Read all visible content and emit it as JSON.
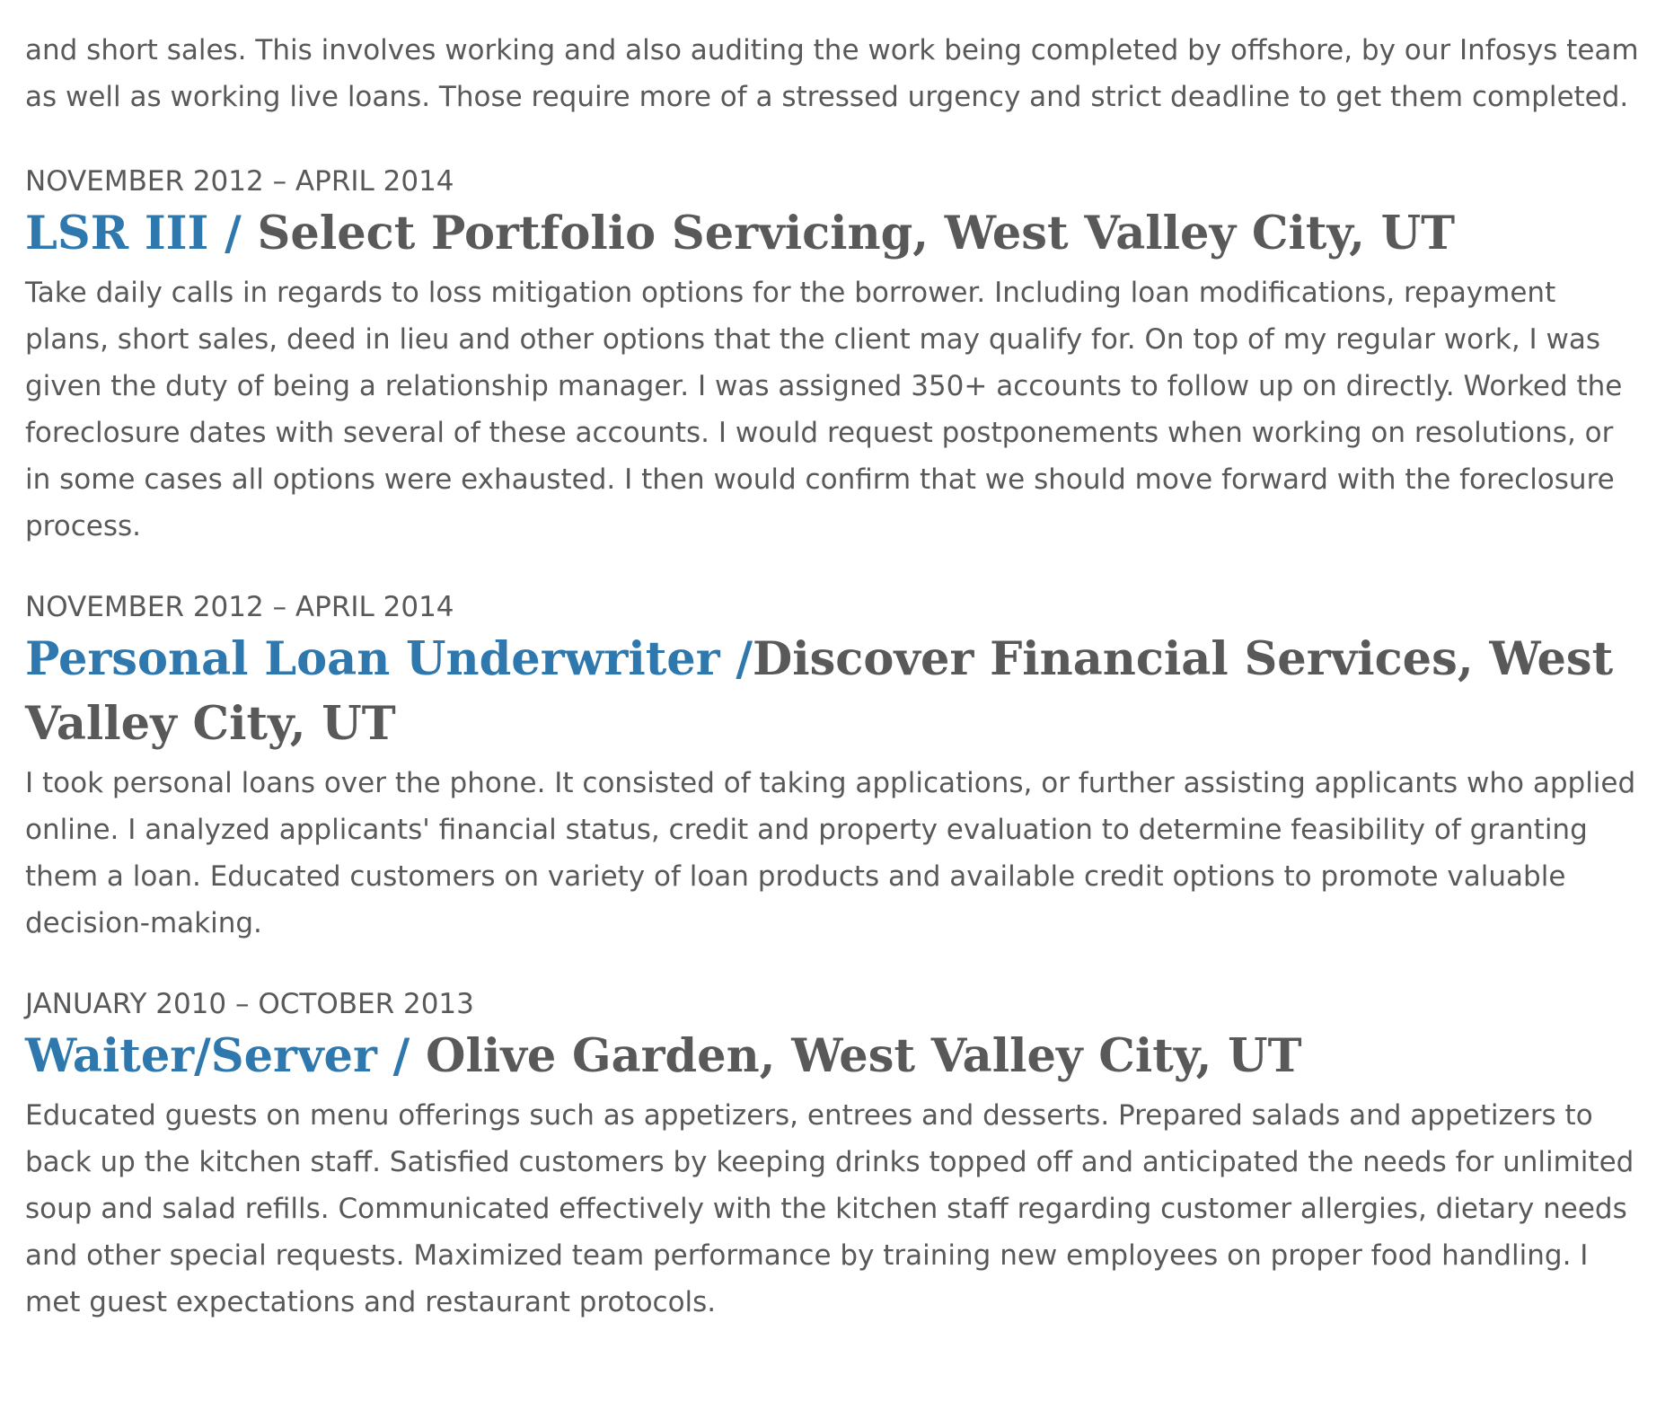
{
  "intro": "and short sales. This involves working and also auditing the work being completed by offshore, by our Infosys team as well as working live loans. Those require more of a stressed urgency and strict deadline to get them completed.",
  "jobs": [
    {
      "dates": "NOVEMBER 2012 – APRIL 2014",
      "role": "LSR III / ",
      "company": "Select Portfolio Servicing, West Valley City, UT",
      "description": "Take daily calls in regards to loss mitigation options for the borrower. Including loan modifications, repayment plans, short sales, deed in lieu and other options that the client may qualify for. On top of my regular work, I was given the duty of being a relationship manager. I was assigned 350+ accounts to follow up on directly. Worked the foreclosure dates with several of these accounts. I would request postponements when working on resolutions, or in some cases all options were exhausted. I then would confirm that we should move forward with the foreclosure process."
    },
    {
      "dates": "NOVEMBER 2012 – APRIL 2014",
      "role": "Personal Loan Underwriter /",
      "company": "Discover Financial Services, West Valley City, UT",
      "description": "I took personal loans over the phone. It consisted of taking applications, or further assisting applicants who applied online. I analyzed applicants' financial status, credit and property evaluation to determine feasibility of granting them a loan. Educated customers on variety of loan products and available credit options to promote valuable decision-making."
    },
    {
      "dates": "JANUARY 2010 – OCTOBER 2013",
      "role": "Waiter/Server / ",
      "company": "Olive Garden, West Valley City, UT",
      "description": "Educated guests on menu offerings such as appetizers, entrees and desserts. Prepared salads and appetizers to back up the kitchen staff. Satisfied customers by keeping drinks topped off and anticipated the needs for unlimited soup and salad refills. Communicated effectively with the kitchen staff regarding customer allergies, dietary needs and other special requests. Maximized team performance by training new employees on proper food handling. I met guest expectations and restaurant protocols."
    }
  ],
  "colors": {
    "role_accent": "#2e78ad",
    "body_text": "#595959"
  }
}
